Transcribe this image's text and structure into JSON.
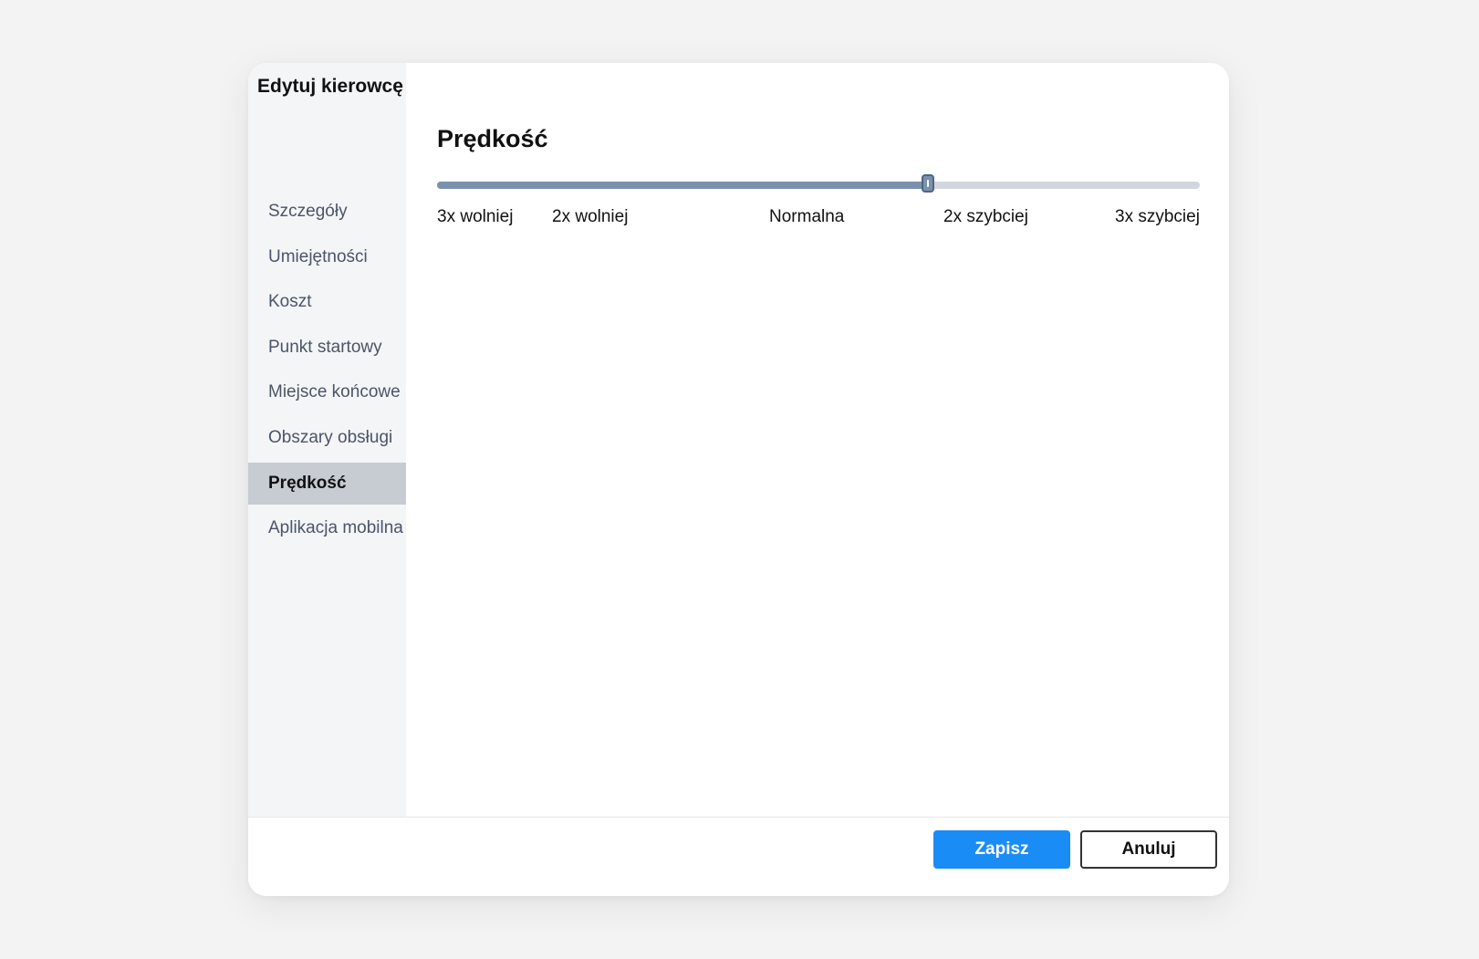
{
  "dialog": {
    "title": "Edytuj kierowcę"
  },
  "sidebar": {
    "items": [
      {
        "label": "Szczegóły",
        "active": false
      },
      {
        "label": "Umiejętności",
        "active": false
      },
      {
        "label": "Koszt",
        "active": false
      },
      {
        "label": "Punkt startowy",
        "active": false
      },
      {
        "label": "Miejsce końcowe",
        "active": false
      },
      {
        "label": "Obszary obsługi",
        "active": false
      },
      {
        "label": "Prędkość",
        "active": true
      },
      {
        "label": "Aplikacja mobilna",
        "active": false
      }
    ]
  },
  "speed": {
    "title": "Prędkość",
    "slider_value_fraction": 0.645,
    "ticks": [
      "3x wolniej",
      "2x wolniej",
      "Normalna",
      "2x szybciej",
      "3x szybciej"
    ]
  },
  "footer": {
    "save_label": "Zapisz",
    "cancel_label": "Anuluj"
  },
  "colors": {
    "accent": "#1a8cf5",
    "slider_fill": "#7a91ad",
    "slider_track": "#d1d6de",
    "sidebar_active_bg": "#c7ccd3"
  }
}
